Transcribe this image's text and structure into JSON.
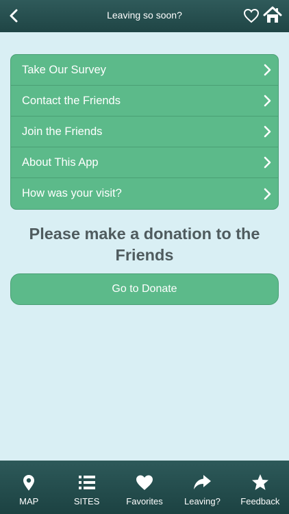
{
  "header": {
    "title": "Leaving so soon?",
    "back_icon": "chevron-left-icon",
    "favorite_icon": "heart-outline-icon",
    "home_icon": "home-icon"
  },
  "menu": {
    "items": [
      {
        "label": "Take Our Survey"
      },
      {
        "label": "Contact the Friends"
      },
      {
        "label": "Join the Friends"
      },
      {
        "label": "About This App"
      },
      {
        "label": "How was your visit?"
      }
    ]
  },
  "donation": {
    "message": "Please make a donation to the Friends",
    "button_label": "Go to Donate"
  },
  "tabbar": {
    "tabs": [
      {
        "label": "MAP",
        "icon": "map-pin-icon"
      },
      {
        "label": "SITES",
        "icon": "list-icon"
      },
      {
        "label": "Favorites",
        "icon": "heart-icon"
      },
      {
        "label": "Leaving?",
        "icon": "share-arrow-icon"
      },
      {
        "label": "Feedback",
        "icon": "star-icon"
      }
    ]
  },
  "colors": {
    "header_bg": "#2f5a5a",
    "page_bg": "#d9eff4",
    "accent_green": "#5cba8a",
    "text_dark": "#4f5b5e"
  }
}
